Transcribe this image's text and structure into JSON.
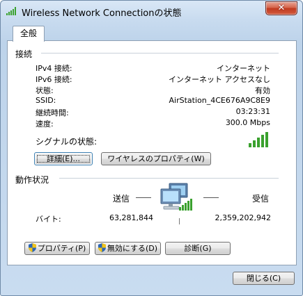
{
  "window": {
    "title": "Wireless Network Connectionの状態",
    "close_label": "✕"
  },
  "tabs": [
    {
      "label": "全般"
    }
  ],
  "connection": {
    "heading": "接続",
    "rows": [
      {
        "label": "IPv4 接続:",
        "value": "インターネット"
      },
      {
        "label": "IPv6 接続:",
        "value": "インターネット アクセスなし"
      },
      {
        "label": "状態:",
        "value": "有効"
      },
      {
        "label": "SSID:",
        "value": "AirStation_4CE676A9C8E9"
      },
      {
        "label": "継続時間:",
        "value": "03:23:31"
      },
      {
        "label": "速度:",
        "value": "300.0 Mbps"
      }
    ],
    "signal_label": "シグナルの状態:",
    "signal_icon": "signal-bars-icon",
    "details_button": "詳細(E)...",
    "wireless_props_button": "ワイヤレスのプロパティ(W)"
  },
  "activity": {
    "heading": "動作状況",
    "sent_label": "送信",
    "received_label": "受信",
    "bytes_label": "バイト:",
    "bytes_sent": "63,281,844",
    "bytes_received": "2,359,202,942",
    "network_icon": "network-computers-icon"
  },
  "actions": {
    "properties_button": "プロパティ(P)",
    "disable_button": "無効にする(D)",
    "diagnose_button": "診断(G)"
  },
  "footer": {
    "close_button": "閉じる(C)"
  },
  "colors": {
    "signal_green": "#3aa12e",
    "window_frame": "#bdd3ea"
  }
}
